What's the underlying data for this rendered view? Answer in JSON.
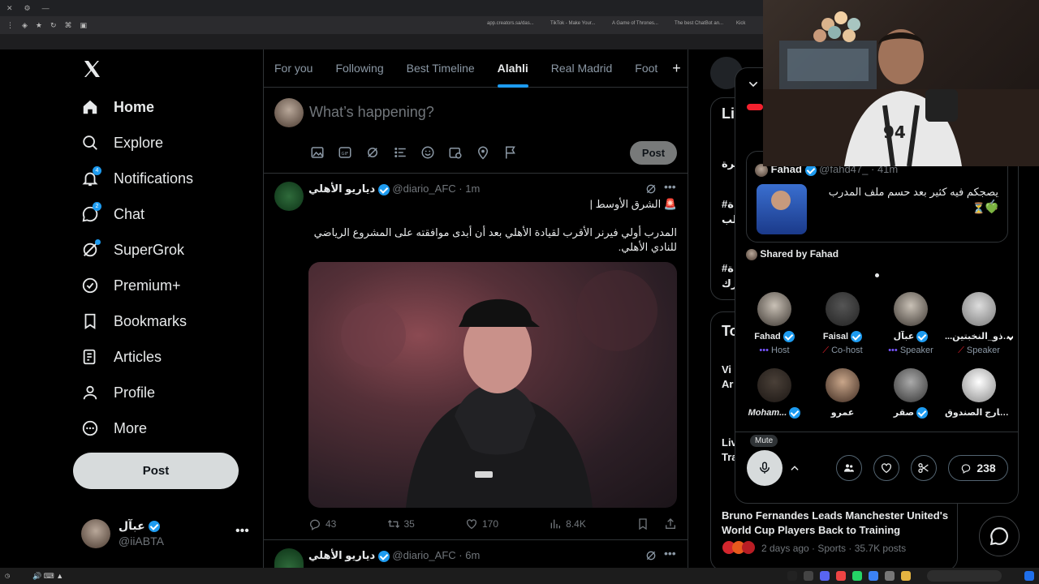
{
  "browser": {
    "bookmarks": [
      "app.creators.sa/das...",
      "TikTok - Make Your...",
      "A Game of Thrones...",
      "The best ChatBot an...",
      "Kick"
    ]
  },
  "nav": {
    "items": [
      {
        "label": "Home",
        "icon": "home-icon"
      },
      {
        "label": "Explore",
        "icon": "search-icon"
      },
      {
        "label": "Notifications",
        "icon": "bell-icon",
        "badge": "4"
      },
      {
        "label": "Chat",
        "icon": "chat-icon",
        "badge": "2"
      },
      {
        "label": "SuperGrok",
        "icon": "grok-icon"
      },
      {
        "label": "Premium+",
        "icon": "verified-icon"
      },
      {
        "label": "Bookmarks",
        "icon": "bookmark-icon"
      },
      {
        "label": "Articles",
        "icon": "articles-icon"
      },
      {
        "label": "Profile",
        "icon": "profile-icon"
      },
      {
        "label": "More",
        "icon": "more-icon"
      }
    ],
    "post_label": "Post",
    "account": {
      "name": "عبآل",
      "handle": "@iiABTA"
    }
  },
  "tabs": [
    "For you",
    "Following",
    "Best Timeline",
    "Alahli",
    "Real Madrid",
    "Foot"
  ],
  "compose": {
    "placeholder": "What’s happening?",
    "post_label": "Post"
  },
  "tweet1": {
    "name": "دياريو الأهلي",
    "handle": "@diario_AFC",
    "time": "· 1m",
    "line1": "🚨 الشرق الأوسط |",
    "body": "المدرب أولي فيرنر الأقرب لقيادة الأهلي بعد أن أبدى موافقته على المشروع الرياضي للنادي الأهلي.",
    "replies": "43",
    "reposts": "35",
    "likes": "170",
    "views": "8.4K"
  },
  "tweet2": {
    "name": "دياريو الأهلي",
    "handle": "@diario_AFC",
    "time": "· 6m"
  },
  "space": {
    "shared_tweet": {
      "name": "Fahad",
      "handle": "@fahd47_",
      "time": "· 41m",
      "text": "يصجكم فيه كثير بعد حسم ملف المدرب ✍🏼",
      "emoji": "💚⏳"
    },
    "shared_by": "Shared by Fahad",
    "speakers": [
      {
        "name": "Fahad",
        "role": "Host"
      },
      {
        "name": "Faisal",
        "role": "Co-host"
      },
      {
        "name": "عبآل",
        "role": "Speaker"
      },
      {
        "name": "...ذو_النخبتين",
        "role": "Speaker"
      },
      {
        "name": "Moham...",
        "role": ""
      },
      {
        "name": "عمرو",
        "role": ""
      },
      {
        "name": "صقر",
        "role": ""
      },
      {
        "name": "خارج الصندوق |...",
        "role": ""
      }
    ],
    "mute_tooltip": "Mute",
    "comments": "238"
  },
  "trending": {
    "headline": "Bruno Fernandes Leads Manchester United's World Cup Players Back to Training",
    "meta": "2 days ago · Sports · 35.7K posts",
    "partial": [
      "Li",
      "يرة",
      "#ة",
      "لب",
      "#ة",
      "رك",
      "To",
      "Vi",
      "Ar",
      "Liv",
      "Tra"
    ]
  }
}
